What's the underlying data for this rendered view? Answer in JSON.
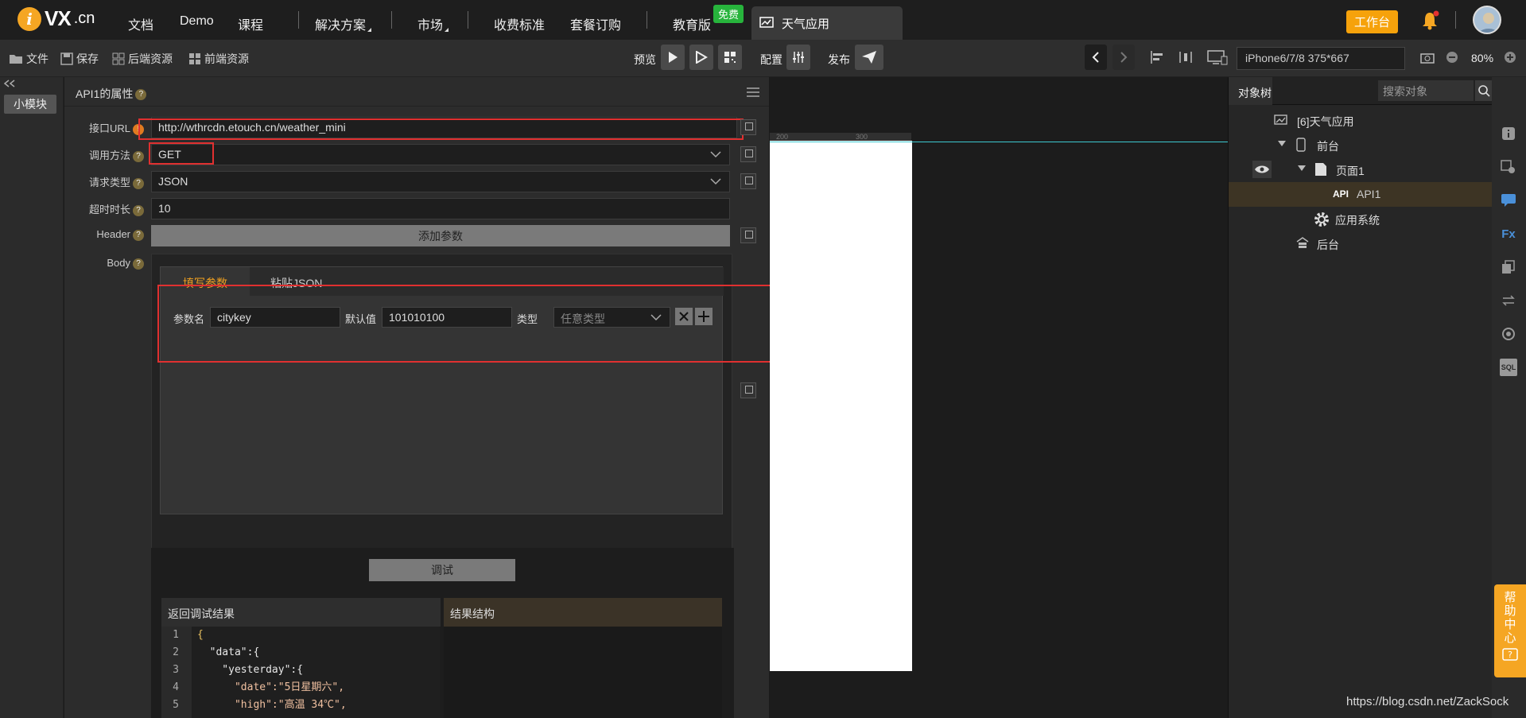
{
  "logo": {
    "letter": "i",
    "brand": "VX",
    "domain": ".cn"
  },
  "nav": {
    "items": [
      "文档",
      "Demo",
      "课程",
      "解决方案",
      "市场",
      "收费标准",
      "套餐订购",
      "教育版"
    ],
    "badge": "免费",
    "app_tab": "天气应用",
    "workbench": "工作台"
  },
  "toolbar": {
    "file": "文件",
    "save": "保存",
    "backend": "后端资源",
    "frontend": "前端资源",
    "preview": "预览",
    "config": "配置",
    "publish": "发布",
    "device": "iPhone6/7/8 375*667",
    "zoom": "80%"
  },
  "left": {
    "mini_module": "小模块"
  },
  "props": {
    "title": "API1的属性",
    "url_label": "接口URL",
    "url_value": "http://wthrcdn.etouch.cn/weather_mini",
    "method_label": "调用方法",
    "method_value": "GET",
    "reqtype_label": "请求类型",
    "reqtype_value": "JSON",
    "timeout_label": "超时时长",
    "timeout_value": "10",
    "header_label": "Header",
    "add_param": "添加参数",
    "body_label": "Body",
    "tab_fill": "填写参数",
    "tab_paste": "粘贴JSON",
    "param_name_label": "参数名",
    "param_name": "citykey",
    "default_label": "默认值",
    "default_value": "101010100",
    "type_label": "类型",
    "type_value": "任意类型",
    "debug_btn": "调试",
    "result_label": "返回调试结果",
    "structure_label": "结果结构",
    "code_lines": [
      "{",
      "  \"data\":{",
      "    \"yesterday\":{",
      "      \"date\":\"5日星期六\",",
      "      \"high\":\"高温 34℃\","
    ],
    "line_numbers": [
      "1",
      "2",
      "3",
      "4",
      "5"
    ]
  },
  "canvas": {
    "ruler_ticks": [
      "200",
      "300"
    ]
  },
  "tree": {
    "title": "对象树",
    "search_placeholder": "搜索对象",
    "nodes": [
      "[6]天气应用",
      "前台",
      "页面1",
      "API1",
      "应用系统",
      "后台"
    ],
    "api_tag": "API"
  },
  "rbar": {
    "icons": [
      "info-icon",
      "settings-icon",
      "chat-icon",
      "fx-icon",
      "copy-icon",
      "swap-icon",
      "target-icon",
      "sql-icon"
    ],
    "fx": "Fx",
    "sql": "SQL"
  },
  "help": "帮助中心",
  "watermark": "https://blog.csdn.net/ZackSock"
}
